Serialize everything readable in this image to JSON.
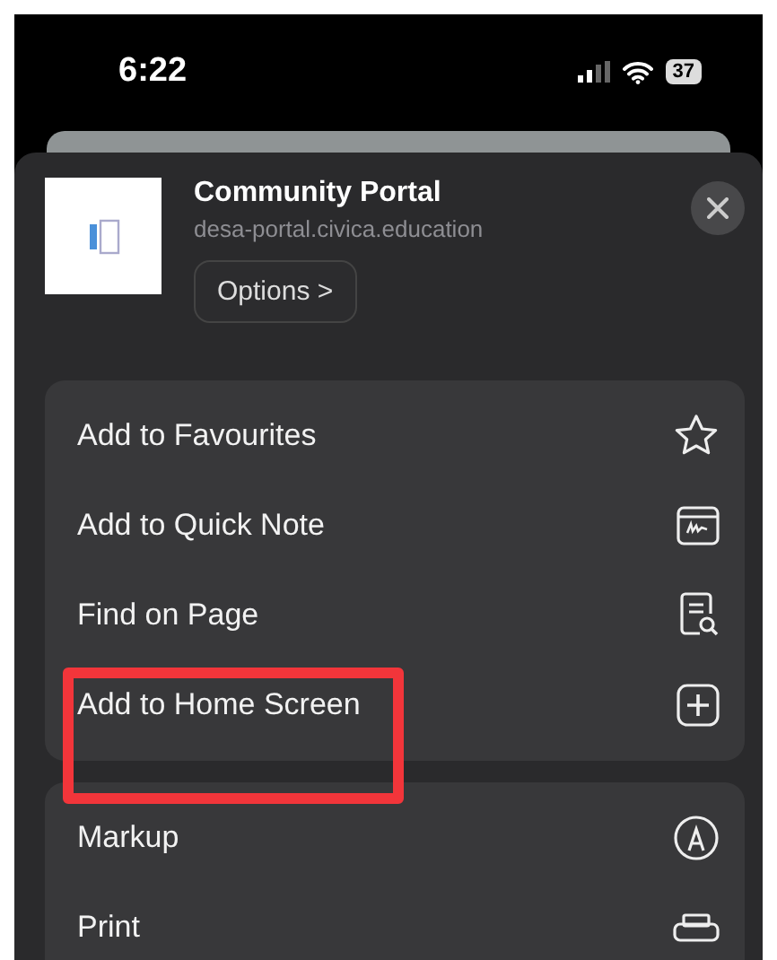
{
  "status_bar": {
    "time": "6:22",
    "battery": "37"
  },
  "header": {
    "title": "Community Portal",
    "url": "desa-portal.civica.education",
    "options_button": "Options >"
  },
  "action_groups": [
    {
      "actions": [
        {
          "label": "Add to Favourites",
          "kind": "star"
        },
        {
          "label": "Add to Quick Note",
          "kind": "note"
        },
        {
          "label": "Find on Page",
          "kind": "find"
        },
        {
          "label": "Add to Home Screen",
          "kind": "add"
        }
      ]
    },
    {
      "actions": [
        {
          "label": "Markup",
          "kind": "markup"
        },
        {
          "label": "Print",
          "kind": "print"
        }
      ]
    }
  ]
}
